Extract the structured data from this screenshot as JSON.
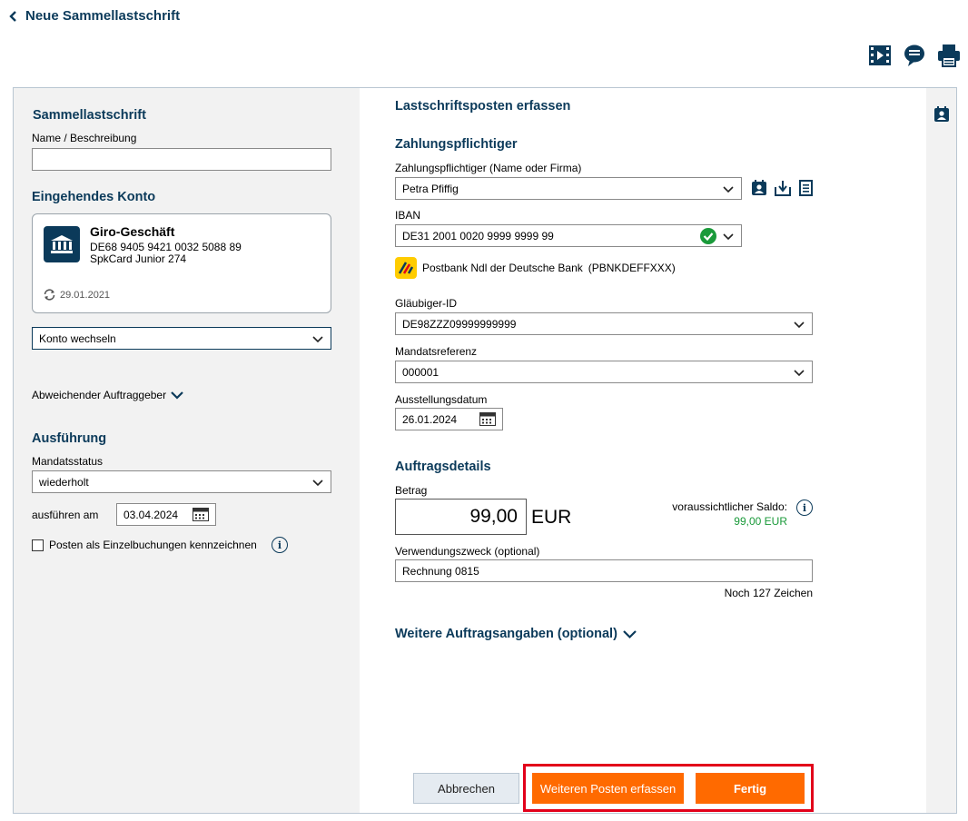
{
  "header": {
    "title": "Neue Sammellastschrift"
  },
  "top_icons": [
    "video-icon",
    "chat-icon",
    "print-icon"
  ],
  "left": {
    "sammel_heading": "Sammellastschrift",
    "name_label": "Name / Beschreibung",
    "name_value": "",
    "konto_heading": "Eingehendes Konto",
    "account": {
      "name": "Giro-Geschäft",
      "iban": "DE68 9405 9421 0032 5088 89",
      "card": "SpkCard Junior 274",
      "sync_date": "29.01.2021"
    },
    "konto_select": "Konto wechseln",
    "abweichender": "Abweichender Auftraggeber",
    "ausfuehrung_heading": "Ausführung",
    "mandatsstatus_label": "Mandatsstatus",
    "mandatsstatus_value": "wiederholt",
    "ausfuehren_label": "ausführen am",
    "ausfuehren_value": "03.04.2024",
    "einzel_label": "Posten als Einzelbuchungen kennzeichnen"
  },
  "main": {
    "heading": "Lastschriftsposten erfassen",
    "zahlungspflichtiger_heading": "Zahlungspflichtiger",
    "payer_label": "Zahlungspflichtiger (Name oder Firma)",
    "payer_value": "Petra Pfiffig",
    "iban_label": "IBAN",
    "iban_value": "DE31 2001 0020 9999 9999 99",
    "bank_name": "Postbank Ndl der Deutsche Bank",
    "bank_bic": "(PBNKDEFFXXX)",
    "glaeubiger_label": "Gläubiger-ID",
    "glaeubiger_value": "DE98ZZZ09999999999",
    "mandat_label": "Mandatsreferenz",
    "mandat_value": "000001",
    "ausstellung_label": "Ausstellungsdatum",
    "ausstellung_value": "26.01.2024",
    "auftragsdetails_heading": "Auftragsdetails",
    "betrag_label": "Betrag",
    "betrag_value": "99,00",
    "currency": "EUR",
    "saldo_label": "voraussichtlicher Saldo:",
    "saldo_value": "99,00 EUR",
    "zweck_label": "Verwendungszweck (optional)",
    "zweck_value": "Rechnung 0815",
    "zeichen": "Noch 127 Zeichen",
    "weitere": "Weitere Auftragsangaben (optional)"
  },
  "buttons": {
    "abbrechen": "Abbrechen",
    "weiteren": "Weiteren Posten erfassen",
    "fertig": "Fertig"
  },
  "colors": {
    "navy": "#0b3a5a",
    "orange": "#ff6a00",
    "green": "#1a9a3a",
    "highlight": "#e2001a"
  }
}
